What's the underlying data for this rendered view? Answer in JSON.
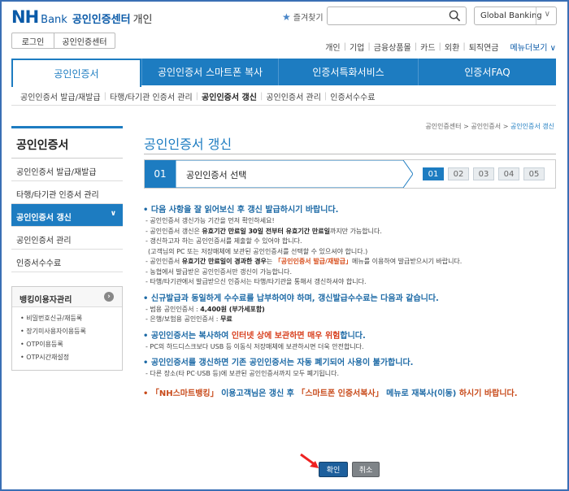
{
  "header": {
    "logo_nh": "NH",
    "logo_bank": "Bank",
    "logo_center": "공인인증센터",
    "logo_type": "개인",
    "favorites_label": "즐겨찾기",
    "search_placeholder": "",
    "global_banking": "Global Banking",
    "login_button": "로그인",
    "cert_center_button": "공인인증센터",
    "category_nav": [
      "개인",
      "기업",
      "금융상품몰",
      "카드",
      "외환",
      "퇴직연금"
    ],
    "more_menu": "메뉴더보기 ∨"
  },
  "tabs": [
    {
      "label": "공인인증서",
      "active": true
    },
    {
      "label": "공인인증서 스마트폰 복사",
      "active": false
    },
    {
      "label": "인증서특화서비스",
      "active": false
    },
    {
      "label": "인증서FAQ",
      "active": false
    }
  ],
  "subnav": [
    {
      "label": "공인인증서 발급/재발급",
      "active": false
    },
    {
      "label": "타행/타기관 인증서 관리",
      "active": false
    },
    {
      "label": "공인인증서 갱신",
      "active": true
    },
    {
      "label": "공인인증서 관리",
      "active": false
    },
    {
      "label": "인증서수수료",
      "active": false
    }
  ],
  "breadcrumb": {
    "items": [
      "공인인증센터",
      "공인인증서"
    ],
    "current": "공인인증서 갱신",
    "separator": ">"
  },
  "sidebar": {
    "title": "공인인증서",
    "items": [
      {
        "label": "공인인증서 발급/재발급",
        "active": false
      },
      {
        "label": "타행/타기관 인증서 관리",
        "active": false
      },
      {
        "label": "공인인증서 갱신",
        "active": true
      },
      {
        "label": "공인인증서 관리",
        "active": false
      },
      {
        "label": "인증서수수료",
        "active": false
      }
    ],
    "bank_box": {
      "title": "뱅킹이용자관리",
      "items": [
        "비밀번호신규/재등록",
        "장기미사용자이용등록",
        "OTP이용등록",
        "OTP시간재설정"
      ]
    }
  },
  "main": {
    "title": "공인인증서 갱신",
    "step_number": "01",
    "step_label": "공인인증서 선택",
    "steps": [
      "01",
      "02",
      "03",
      "04",
      "05"
    ],
    "active_step": "01",
    "notice1": {
      "head": "• 다음 사항을 잘 읽어보신 후 갱신 발급하시기 바랍니다.",
      "l1": "- 공인인증서 갱신가능 기간을 먼저 확인하세요!",
      "l2a": "- 공인인증서 갱신은 ",
      "l2b": "유효기간 만료일 30일 전부터 유효기간 만료일",
      "l2c": "까지만 가능합니다.",
      "l3": "- 갱신하고자 하는 공인인증서를 제출할 수 있어야 합니다.",
      "l4": "(고객님의 PC 또는 저장매체에 보관된 공인인증서를 선택할 수 있으셔야 합니다.)",
      "l5a": "- 공인인증서 ",
      "l5b": "유효기간 만료일이 경과한 경우",
      "l5c": "는 ",
      "l5d": "「공인인증서 발급/재발급」",
      "l5e": "메뉴를 이용하여 발급받으시기 바랍니다.",
      "l6": "- 농협에서 발급받은 공인인증서만 갱신이 가능합니다.",
      "l7": "- 타행/타기관에서 발급받으신 인증서는 타행/타기관을 통해서 갱신하셔야 합니다."
    },
    "notice2": {
      "head": "• 신규발급과 동일하게 수수료를 납부하여야 하며, 갱신발급수수료는 다음과 같습니다.",
      "l1a": "- 범용 공인인증서 : ",
      "l1b": "4,400원 (부가세포함)",
      "l2a": "- 은행/보험용 공인인증서 : ",
      "l2b": "무료"
    },
    "notice3": {
      "head_a": "• 공인인증서는 복사하여 ",
      "head_b": "인터넷 상에 보관하면 매우 위험",
      "head_c": "합니다.",
      "l1": "- PC의 하드디스크보다 USB 등 이동식 저장매체에 보관하시면 더욱 안전합니다."
    },
    "notice4": {
      "head": "• 공인인증서를 갱신하면 기존 공인인증서는 자동 폐기되어 사용이 불가합니다.",
      "l1": "- 다른 장소(타 PC·USB 등)에 보관된 공인인증서까지 모두 폐기됩니다."
    },
    "final_a": "• 「NH스마트뱅킹」 ",
    "final_b": "이용고객님은 갱신 후 ",
    "final_c": "「스마트폰 인증서복사」",
    "final_d": " 메뉴로 재복사(이동)",
    "final_e": " 하시기 바랍니다.",
    "confirm_button": "확인",
    "cancel_button": "취소"
  },
  "colors": {
    "brand_blue": "#1d7cc1",
    "frame_blue": "#3a6fb5",
    "highlight_orange": "#d8401f"
  }
}
